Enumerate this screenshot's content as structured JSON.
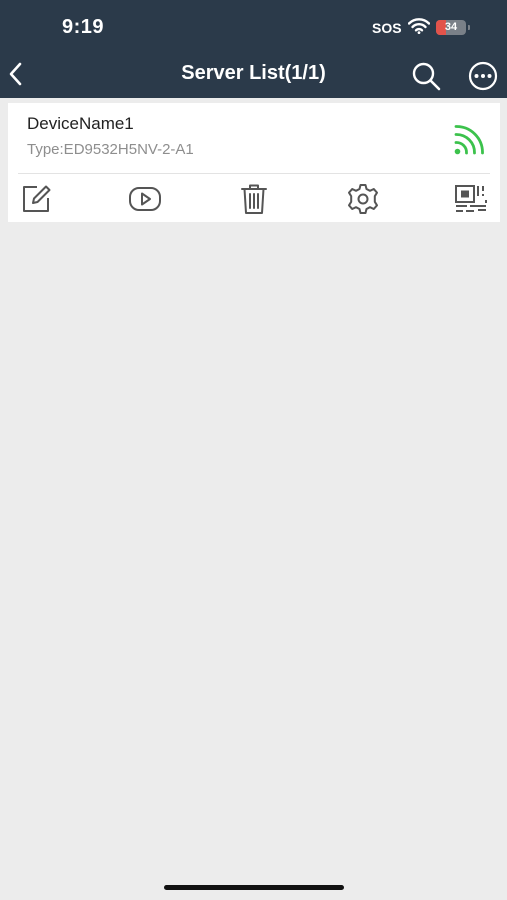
{
  "status_bar": {
    "time": "9:19",
    "carrier": "SOS",
    "battery_level": "34",
    "battery_fraction": 0.34,
    "icons": [
      "wifi-icon",
      "battery-icon"
    ]
  },
  "nav_bar": {
    "title": "Server List(1/1)",
    "icons": [
      "back-chevron-icon",
      "search-icon",
      "more-options-icon"
    ]
  },
  "devices": [
    {
      "name": "DeviceName1",
      "type": "Type:ED9532H5NV-2-A1",
      "status_icon": "online-signal-icon",
      "actions": [
        "edit-icon",
        "play-icon",
        "delete-icon",
        "settings-icon",
        "qr-code-icon"
      ]
    }
  ],
  "colors": {
    "header_bg": "#2b3a4a",
    "page_bg": "#ececec",
    "card_bg": "#ffffff",
    "online_green": "#3cc24c",
    "icon_gray": "#555555",
    "secondary_text": "#8e8e8e"
  }
}
